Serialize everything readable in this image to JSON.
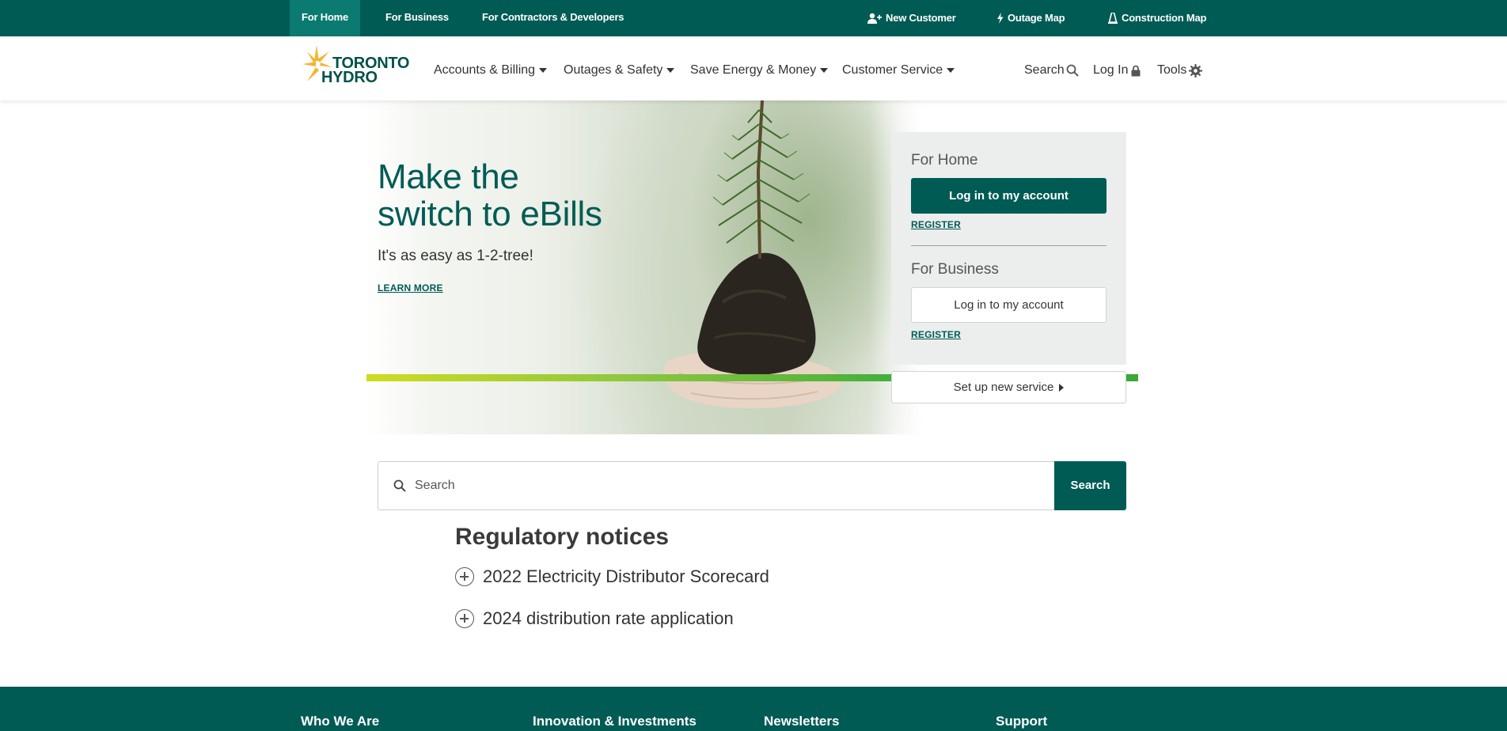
{
  "topbar": {
    "tabs": [
      {
        "label": "For Home",
        "active": true
      },
      {
        "label": "For Business",
        "active": false
      },
      {
        "label": "For Contractors & Developers",
        "active": false
      }
    ],
    "utilities": {
      "new_customer": "New Customer",
      "outage_map": "Outage Map",
      "construction_map": "Construction Map"
    }
  },
  "nav": {
    "logo": {
      "line1": "TORONTO",
      "line2": "HYDRO"
    },
    "items": [
      {
        "label": "Accounts & Billing"
      },
      {
        "label": "Outages & Safety"
      },
      {
        "label": "Save Energy & Money"
      },
      {
        "label": "Customer Service"
      }
    ],
    "search_label": "Search",
    "login_label": "Log In",
    "tools_label": "Tools"
  },
  "hero": {
    "title_line1": "Make the",
    "title_line2": "switch to eBills",
    "subtitle": "It's as easy as 1-2-tree!",
    "link": "LEARN MORE"
  },
  "login_panel": {
    "home": {
      "heading": "For Home",
      "button": "Log in to my account",
      "register": "REGISTER"
    },
    "business": {
      "heading": "For Business",
      "button": "Log in to my account",
      "register": "REGISTER"
    },
    "new_service": "Set up new service"
  },
  "search": {
    "placeholder": "Search",
    "button": "Search"
  },
  "regulatory": {
    "title": "Regulatory notices",
    "items": [
      {
        "label": "2022 Electricity Distributor Scorecard"
      },
      {
        "label": "2024 distribution rate application"
      }
    ]
  },
  "footer": {
    "columns": [
      "Who We Are",
      "Innovation & Investments",
      "Newsletters",
      "Support"
    ]
  },
  "colors": {
    "brand_green": "#005b55",
    "active_tab": "#0b7a70",
    "logo_gold": "#f2b632"
  }
}
